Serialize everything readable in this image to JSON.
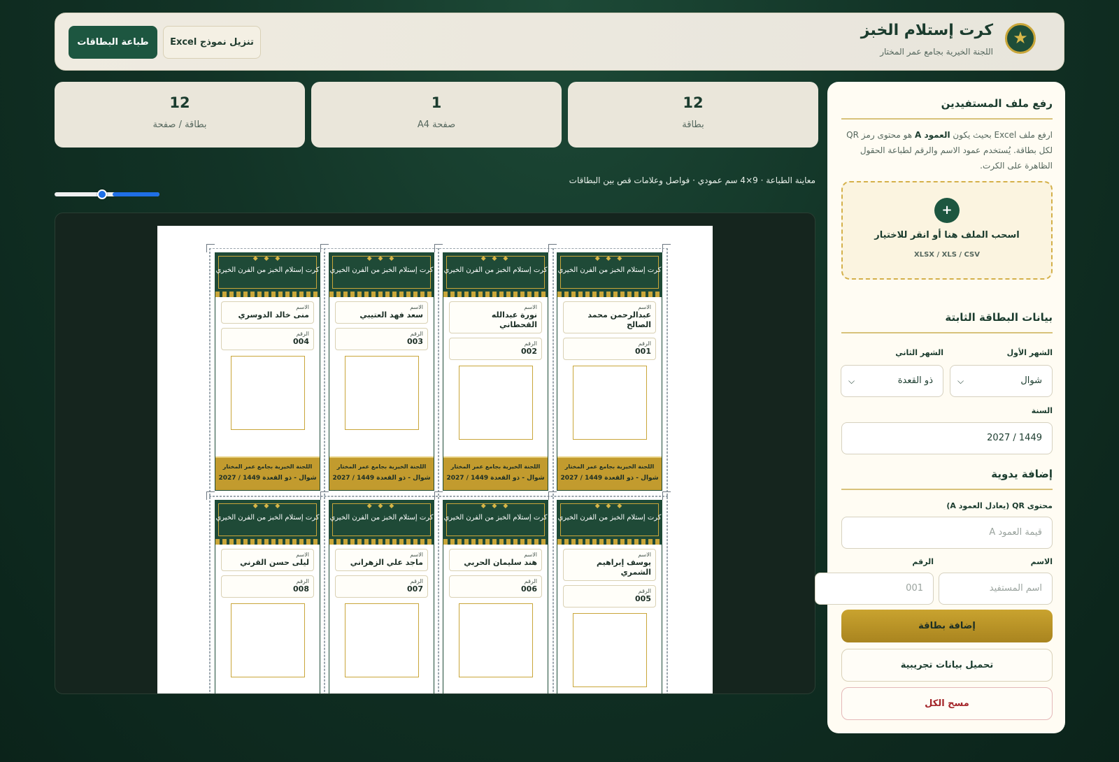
{
  "header": {
    "title": "كرت إستلام الخبز",
    "subtitle": "اللجنة الخيرية بجامع عمر المختار",
    "logo_icon": "star-icon",
    "print_button": "طباعة البطاقات",
    "excel_button": "تنزيل نموذج Excel"
  },
  "stats": [
    {
      "value": "12",
      "label": "بطاقة"
    },
    {
      "value": "1",
      "label": "صفحة A4"
    },
    {
      "value": "12",
      "label": "بطاقة / صفحة"
    }
  ],
  "preview": {
    "label": "معاينة الطباعة · 9×4 سم عمودي · فواصل وعلامات قص بين البطاقات",
    "zoom_value": 0.55
  },
  "card_template": {
    "title": "كرت إستلام الخبز من الفرن الخيري",
    "dots": "◆ ◆ ◆",
    "name_label": "الاسم",
    "number_label": "الرقم",
    "footer_line1": "اللجنة الخيرية بجامع عمر المختار",
    "footer_line2": "شوال - ذو القعدة 1449 / 2027"
  },
  "cards": [
    {
      "name": "عبدالرحمن محمد الصالح",
      "number": "001"
    },
    {
      "name": "نورة عبدالله القحطاني",
      "number": "002"
    },
    {
      "name": "سعد فهد العتيبي",
      "number": "003"
    },
    {
      "name": "منى خالد الدوسري",
      "number": "004"
    },
    {
      "name": "يوسف إبراهيم الشمري",
      "number": "005"
    },
    {
      "name": "هند سليمان الحربي",
      "number": "006"
    },
    {
      "name": "ماجد علي الزهراني",
      "number": "007"
    },
    {
      "name": "ليلى حسن القرني",
      "number": "008"
    }
  ],
  "upload": {
    "title": "رفع ملف المستفيدين",
    "desc_1": "ارفع ملف Excel بحيث يكون ",
    "desc_bold": "العمود A",
    "desc_2": " هو محتوى رمز QR لكل بطاقة. يُستخدم عمود الاسم والرقم لطباعة الحقول الظاهرة على الكرت.",
    "drop_icon": "plus-icon",
    "drop_text": "اسحب الملف هنا أو انقر للاختيار",
    "drop_formats": "XLSX / XLS / CSV"
  },
  "fixed": {
    "title": "بيانات البطاقة الثابتة",
    "month1_label": "الشهر الأول",
    "month1_value": "شوال",
    "month2_label": "الشهر الثاني",
    "month2_value": "ذو القعدة",
    "year_label": "السنة",
    "year_value": "1449 / 2027"
  },
  "manual": {
    "title": "إضافة يدوية",
    "qr_label": "محتوى QR (يعادل العمود A)",
    "qr_placeholder": "قيمة العمود A",
    "name_label": "الاسم",
    "name_placeholder": "اسم المستفيد",
    "number_label": "الرقم",
    "number_placeholder": "001",
    "add_button": "إضافة بطاقة",
    "demo_button": "تحميل بيانات تجريبية",
    "clear_button": "مسح الكل"
  }
}
